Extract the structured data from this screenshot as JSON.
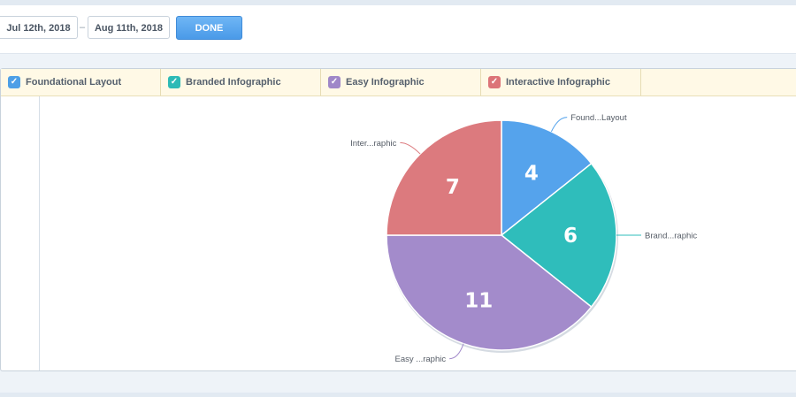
{
  "toolbar": {
    "start_date": "Jul 12th, 2018",
    "separator": "–",
    "end_date": "Aug 11th, 2018",
    "done_label": "DONE"
  },
  "legend": {
    "items": [
      {
        "label": "Foundational Layout",
        "color": "#4d9fe6",
        "checked": true,
        "icon": "check-icon"
      },
      {
        "label": "Branded Infographic",
        "color": "#2dbab6",
        "checked": true,
        "icon": "check-icon"
      },
      {
        "label": "Easy Infographic",
        "color": "#9f87c8",
        "checked": true,
        "icon": "check-icon"
      },
      {
        "label": "Interactive Infographic",
        "color": "#dc7478",
        "checked": true,
        "icon": "check-icon"
      }
    ]
  },
  "chart_data": {
    "type": "pie",
    "title": "",
    "slices": [
      {
        "label": "Found...Layout",
        "value": 4,
        "color": "#55a3ec"
      },
      {
        "label": "Brand...raphic",
        "value": 6,
        "color": "#2fbdbb"
      },
      {
        "label": "Easy ...raphic",
        "value": 11,
        "color": "#a38bcb"
      },
      {
        "label": "Inter...raphic",
        "value": 7,
        "color": "#dc7a7e"
      }
    ],
    "start_angle": "12 o'clock",
    "direction": "clockwise",
    "value_labels": "inside slices",
    "category_labels": "outside with leader lines"
  }
}
